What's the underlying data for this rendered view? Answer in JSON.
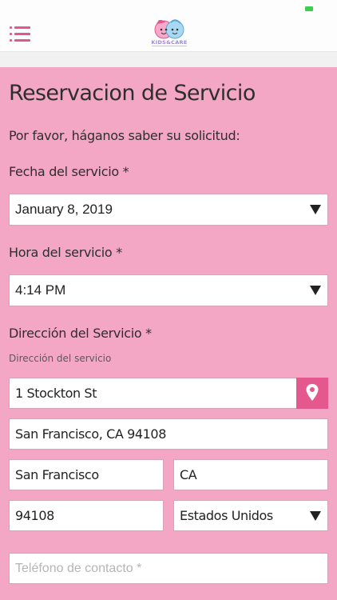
{
  "header": {
    "logo_text": "KIDS&CARE",
    "menu_icon": "menu-icon",
    "accent_color": "#e0588f"
  },
  "form": {
    "title": "Reservacion de Servicio",
    "intro": "Por favor, háganos saber su solicitud:",
    "date_label": "Fecha del servicio *",
    "date_value": "January 8, 2019",
    "time_label": "Hora del servicio *",
    "time_value": "4:14 PM",
    "address_label": "Dirección del Servicio *",
    "address_sublabel": "Dirección del servicio",
    "street_value": "1 Stockton St",
    "full_address_value": "San Francisco, CA  94108",
    "city_value": "San Francisco",
    "state_value": "CA",
    "zip_value": "94108",
    "country_value": "Estados Unidos",
    "phone_placeholder": "Teléfono de contacto *",
    "location_icon": "map-pin-icon",
    "background_color": "#f4a7c5"
  }
}
